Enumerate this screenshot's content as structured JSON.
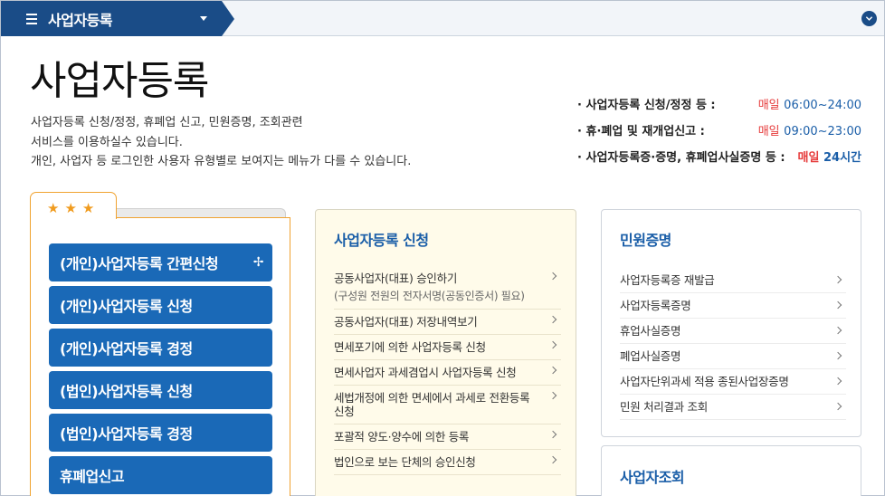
{
  "topbar": {
    "menu_title": "사업자등록",
    "menu_icon": "hamburger-icon",
    "expand_icon": "chevron-down-icon"
  },
  "page": {
    "title": "사업자등록",
    "description": [
      "사업자등록 신청/정정, 휴폐업 신고, 민원증명, 조회관련",
      "서비스를 이용하실수 있습니다.",
      "개인, 사업자 등 로그인한 사용자 유형별로 보여지는 메뉴가 다를 수 있습니다."
    ]
  },
  "hours": [
    {
      "label": "· 사업자등록 신청/정정 등 :",
      "daily": "매일",
      "time": "06:00~24:00"
    },
    {
      "label": "· 휴·폐업 및 재개업신고 :",
      "daily": "매일",
      "time": "09:00~23:00"
    },
    {
      "label": "· 사업자등록증·증명, 휴폐업사실증명 등 :",
      "daily": "매일",
      "time": "24시간"
    }
  ],
  "favorites": {
    "star_icon": "star-icon",
    "items": [
      {
        "label": "(개인)사업자등록 간편신청",
        "has_plus": true
      },
      {
        "label": "(개인)사업자등록 신청"
      },
      {
        "label": "(개인)사업자등록 경정"
      },
      {
        "label": "(법인)사업자등록 신청"
      },
      {
        "label": "(법인)사업자등록 경정"
      },
      {
        "label": "휴폐업신고"
      }
    ],
    "plus_symbol": "✢"
  },
  "business_registration": {
    "title": "사업자등록 신청",
    "items": [
      {
        "label": "공동사업자(대표) 승인하기",
        "sub": "(구성원 전원의 전자서명(공동인증서) 필요)"
      },
      {
        "label": "공동사업자(대표) 저장내역보기"
      },
      {
        "label": "면세포기에 의한 사업자등록 신청"
      },
      {
        "label": "면세사업자 과세겸업시 사업자등록 신청"
      },
      {
        "label": "세법개정에 의한 면세에서 과세로 전환등록 신청"
      },
      {
        "label": "포괄적 양도·양수에 의한 등록"
      },
      {
        "label": "법인으로 보는 단체의 승인신청"
      }
    ]
  },
  "civil_petition": {
    "title": "민원증명",
    "items": [
      {
        "label": "사업자등록증 재발급"
      },
      {
        "label": "사업자등록증명"
      },
      {
        "label": "휴업사실증명"
      },
      {
        "label": "폐업사실증명"
      },
      {
        "label": "사업자단위과세 적용 종된사업장증명"
      },
      {
        "label": "민원 처리결과 조회"
      }
    ]
  },
  "business_lookup": {
    "title": "사업자조회"
  }
}
